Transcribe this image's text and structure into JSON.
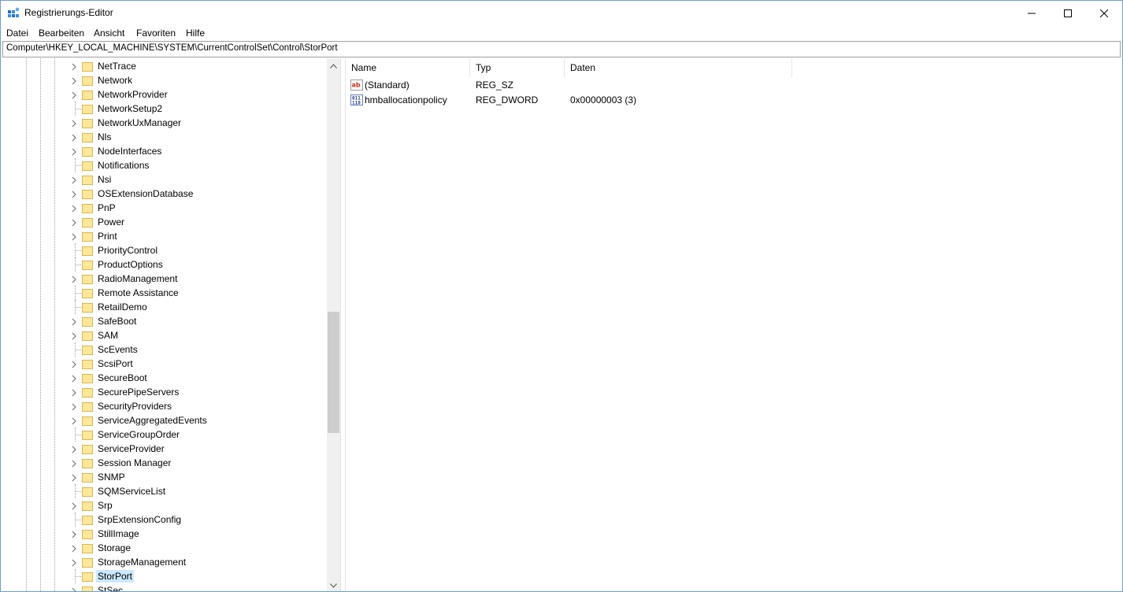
{
  "window": {
    "title": "Registrierungs-Editor",
    "controls": [
      "minimize-icon",
      "maximize-icon",
      "close-icon"
    ]
  },
  "menu": {
    "items": [
      "Datei",
      "Bearbeiten",
      "Ansicht",
      "Favoriten",
      "Hilfe"
    ]
  },
  "address": {
    "path": "Computer\\HKEY_LOCAL_MACHINE\\SYSTEM\\CurrentControlSet\\Control\\StorPort"
  },
  "tree": {
    "items": [
      {
        "label": "NetTrace",
        "expandable": true
      },
      {
        "label": "Network",
        "expandable": true
      },
      {
        "label": "NetworkProvider",
        "expandable": true
      },
      {
        "label": "NetworkSetup2",
        "expandable": false
      },
      {
        "label": "NetworkUxManager",
        "expandable": true
      },
      {
        "label": "Nls",
        "expandable": true
      },
      {
        "label": "NodeInterfaces",
        "expandable": true
      },
      {
        "label": "Notifications",
        "expandable": false
      },
      {
        "label": "Nsi",
        "expandable": true
      },
      {
        "label": "OSExtensionDatabase",
        "expandable": true
      },
      {
        "label": "PnP",
        "expandable": true
      },
      {
        "label": "Power",
        "expandable": true
      },
      {
        "label": "Print",
        "expandable": true
      },
      {
        "label": "PriorityControl",
        "expandable": false
      },
      {
        "label": "ProductOptions",
        "expandable": false
      },
      {
        "label": "RadioManagement",
        "expandable": true
      },
      {
        "label": "Remote Assistance",
        "expandable": false
      },
      {
        "label": "RetailDemo",
        "expandable": false
      },
      {
        "label": "SafeBoot",
        "expandable": true
      },
      {
        "label": "SAM",
        "expandable": true
      },
      {
        "label": "ScEvents",
        "expandable": false
      },
      {
        "label": "ScsiPort",
        "expandable": true
      },
      {
        "label": "SecureBoot",
        "expandable": true
      },
      {
        "label": "SecurePipeServers",
        "expandable": true
      },
      {
        "label": "SecurityProviders",
        "expandable": true
      },
      {
        "label": "ServiceAggregatedEvents",
        "expandable": true
      },
      {
        "label": "ServiceGroupOrder",
        "expandable": false
      },
      {
        "label": "ServiceProvider",
        "expandable": true
      },
      {
        "label": "Session Manager",
        "expandable": true
      },
      {
        "label": "SNMP",
        "expandable": true
      },
      {
        "label": "SQMServiceList",
        "expandable": false
      },
      {
        "label": "Srp",
        "expandable": true
      },
      {
        "label": "SrpExtensionConfig",
        "expandable": false
      },
      {
        "label": "StillImage",
        "expandable": true
      },
      {
        "label": "Storage",
        "expandable": true
      },
      {
        "label": "StorageManagement",
        "expandable": true
      },
      {
        "label": "StorPort",
        "expandable": false,
        "selected": true
      },
      {
        "label": "StSec",
        "expandable": true
      }
    ]
  },
  "list": {
    "columns": [
      "Name",
      "Typ",
      "Daten"
    ],
    "rows": [
      {
        "name": "(Standard)",
        "type": "REG_SZ",
        "data": "",
        "icon": "string-value-icon"
      },
      {
        "name": "hmballocationpolicy",
        "type": "REG_DWORD",
        "data": "0x00000003 (3)",
        "icon": "binary-value-icon"
      }
    ]
  },
  "colors": {
    "selection": "#cce8ff",
    "folder": "#ffe79a",
    "scrollbar_thumb": "#cdcdcd",
    "window_border": "#6d9ecf"
  }
}
